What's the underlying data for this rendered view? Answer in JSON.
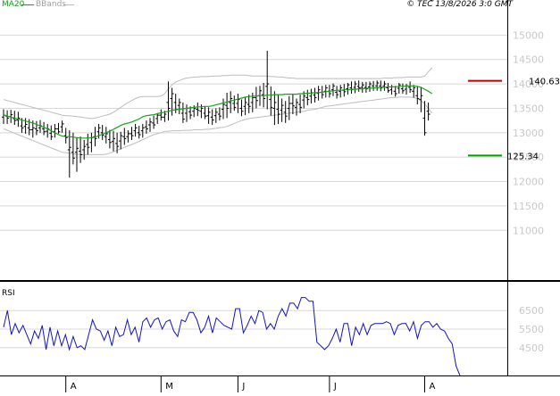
{
  "header": {
    "ma_label": "MA20",
    "bb_label": "BBands",
    "copyright": "© TEC 13/8/2026 3:0 GMT"
  },
  "colors": {
    "price_bars": "#000000",
    "ma": "#18a21b",
    "bbands": "#bdbdbd",
    "rsi": "#1515b8",
    "resistance": "#c00000",
    "support": "#00a000",
    "grid": "#d8d8d8",
    "frame": "#000000",
    "tick_text": "#c8c8c8"
  },
  "chart_data": [
    {
      "type": "bar",
      "subtype": "ohlc",
      "x_labels": [
        "A",
        "M",
        "J",
        "J",
        "A"
      ],
      "x_label_bar_index": [
        17,
        43,
        64,
        89,
        115
      ],
      "ylim": [
        1000,
        1550
      ],
      "y_ticks": [
        "11000",
        "11500",
        "12000",
        "12500",
        "13000",
        "13500",
        "14000",
        "14500",
        "15000"
      ],
      "y_tick_values": [
        1100,
        1150,
        1200,
        1250,
        1300,
        1350,
        1400,
        1450,
        1500
      ],
      "grid": true,
      "levels": [
        {
          "label": "140.63",
          "value": 1406.3,
          "kind": "resistance"
        },
        {
          "label": "125.34",
          "value": 1253.4,
          "kind": "support"
        }
      ],
      "series": [
        {
          "name": "MA20",
          "kind": "moving-average",
          "values": [
            1337,
            1334,
            1332,
            1330,
            1328,
            1326,
            1324,
            1322,
            1320,
            1317,
            1314,
            1311,
            1308,
            1304,
            1300,
            1296,
            1293,
            1292,
            1292,
            1291,
            1290,
            1289,
            1289,
            1289,
            1290,
            1291,
            1294,
            1297,
            1300,
            1303,
            1307,
            1311,
            1315,
            1318,
            1320,
            1322,
            1325,
            1328,
            1333,
            1335,
            1336,
            1337,
            1339,
            1341,
            1342,
            1344,
            1346,
            1347,
            1348,
            1349,
            1350,
            1351,
            1352,
            1353,
            1353,
            1354,
            1354,
            1355,
            1357,
            1359,
            1361,
            1363,
            1365,
            1367,
            1369,
            1371,
            1373,
            1374,
            1375,
            1375,
            1376,
            1376,
            1377,
            1377,
            1378,
            1378,
            1378,
            1379,
            1379,
            1379,
            1379,
            1380,
            1380,
            1381,
            1381,
            1382,
            1382,
            1383,
            1384,
            1385,
            1386,
            1387,
            1387,
            1388,
            1388,
            1389,
            1389,
            1390,
            1390,
            1391,
            1391,
            1392,
            1392,
            1393,
            1393,
            1394,
            1394,
            1394,
            1395,
            1395,
            1396,
            1396,
            1396,
            1395,
            1393,
            1389,
            1385,
            1380
          ]
        },
        {
          "name": "BBands",
          "kind": "band-upper",
          "values": [
            1368,
            1366,
            1364,
            1362,
            1360,
            1358,
            1356,
            1354,
            1352,
            1350,
            1348,
            1346,
            1344,
            1342,
            1340,
            1338,
            1336,
            1335,
            1335,
            1334,
            1333,
            1332,
            1331,
            1330,
            1329,
            1330,
            1332,
            1334,
            1336,
            1338,
            1342,
            1347,
            1352,
            1357,
            1362,
            1366,
            1370,
            1373,
            1374,
            1374,
            1374,
            1374,
            1374,
            1375,
            1380,
            1390,
            1398,
            1404,
            1407,
            1410,
            1412,
            1413,
            1414,
            1414,
            1415,
            1415,
            1415,
            1416,
            1416,
            1416,
            1417,
            1417,
            1418,
            1418,
            1418,
            1418,
            1418,
            1417,
            1416,
            1416,
            1416,
            1416,
            1416,
            1415,
            1415,
            1414,
            1414,
            1413,
            1412,
            1412,
            1411,
            1411,
            1411,
            1411,
            1411,
            1411,
            1411,
            1411,
            1411,
            1411,
            1411,
            1411,
            1411,
            1411,
            1411,
            1411,
            1411,
            1411,
            1411,
            1411,
            1411,
            1411,
            1411,
            1411,
            1412,
            1412,
            1412,
            1413,
            1413,
            1413,
            1414,
            1414,
            1414,
            1414,
            1414,
            1416,
            1425,
            1433
          ]
        },
        {
          "name": "BBands",
          "kind": "band-lower",
          "values": [
            1308,
            1305,
            1302,
            1299,
            1296,
            1293,
            1290,
            1287,
            1284,
            1281,
            1278,
            1275,
            1272,
            1269,
            1266,
            1263,
            1260,
            1259,
            1258,
            1257,
            1256,
            1255,
            1255,
            1255,
            1255,
            1255,
            1255,
            1255,
            1256,
            1258,
            1261,
            1264,
            1267,
            1270,
            1273,
            1276,
            1279,
            1282,
            1286,
            1289,
            1293,
            1296,
            1298,
            1300,
            1303,
            1303,
            1304,
            1304,
            1304,
            1305,
            1305,
            1305,
            1306,
            1306,
            1306,
            1307,
            1307,
            1308,
            1309,
            1310,
            1311,
            1313,
            1316,
            1319,
            1322,
            1325,
            1327,
            1329,
            1330,
            1331,
            1332,
            1333,
            1334,
            1335,
            1336,
            1337,
            1338,
            1339,
            1340,
            1341,
            1342,
            1343,
            1344,
            1346,
            1347,
            1348,
            1350,
            1352,
            1354,
            1355,
            1356,
            1357,
            1358,
            1359,
            1360,
            1361,
            1362,
            1363,
            1364,
            1365,
            1366,
            1367,
            1368,
            1369,
            1370,
            1371,
            1372,
            1372,
            1373,
            1373,
            1373,
            1373,
            1372,
            1370,
            1366,
            1359,
            1350,
            1340
          ]
        },
        {
          "name": "price",
          "kind": "ohlc-bars",
          "high": [
            1348,
            1346,
            1347,
            1345,
            1343,
            1330,
            1330,
            1328,
            1325,
            1324,
            1326,
            1322,
            1318,
            1315,
            1318,
            1320,
            1325,
            1310,
            1305,
            1300,
            1290,
            1292,
            1285,
            1298,
            1300,
            1312,
            1318,
            1316,
            1312,
            1306,
            1304,
            1300,
            1302,
            1310,
            1305,
            1312,
            1318,
            1314,
            1318,
            1325,
            1330,
            1335,
            1340,
            1348,
            1345,
            1405,
            1392,
            1380,
            1370,
            1362,
            1358,
            1354,
            1356,
            1362,
            1358,
            1354,
            1352,
            1348,
            1350,
            1352,
            1370,
            1382,
            1385,
            1376,
            1380,
            1368,
            1372,
            1378,
            1382,
            1394,
            1396,
            1402,
            1468,
            1395,
            1385,
            1378,
            1370,
            1365,
            1375,
            1380,
            1370,
            1378,
            1385,
            1388,
            1390,
            1392,
            1396,
            1396,
            1398,
            1398,
            1401,
            1396,
            1398,
            1400,
            1402,
            1405,
            1406,
            1407,
            1404,
            1404,
            1405,
            1406,
            1407,
            1407,
            1406,
            1402,
            1398,
            1396,
            1402,
            1401,
            1400,
            1405,
            1398,
            1395,
            1394,
            1365,
            1362
          ],
          "low": [
            1318,
            1318,
            1320,
            1316,
            1312,
            1300,
            1298,
            1295,
            1290,
            1295,
            1300,
            1295,
            1290,
            1285,
            1290,
            1298,
            1300,
            1278,
            1208,
            1235,
            1220,
            1238,
            1245,
            1255,
            1260,
            1272,
            1288,
            1285,
            1278,
            1268,
            1262,
            1258,
            1266,
            1275,
            1280,
            1285,
            1292,
            1288,
            1290,
            1298,
            1302,
            1308,
            1318,
            1325,
            1322,
            1325,
            1335,
            1340,
            1338,
            1320,
            1322,
            1328,
            1332,
            1334,
            1330,
            1328,
            1318,
            1316,
            1320,
            1325,
            1328,
            1330,
            1340,
            1345,
            1340,
            1334,
            1336,
            1340,
            1342,
            1350,
            1355,
            1352,
            1348,
            1335,
            1316,
            1318,
            1322,
            1320,
            1326,
            1338,
            1335,
            1340,
            1350,
            1356,
            1360,
            1362,
            1366,
            1370,
            1372,
            1372,
            1375,
            1370,
            1372,
            1374,
            1378,
            1380,
            1381,
            1384,
            1382,
            1382,
            1384,
            1386,
            1386,
            1385,
            1386,
            1382,
            1378,
            1374,
            1380,
            1380,
            1378,
            1382,
            1372,
            1358,
            1342,
            1294,
            1325
          ],
          "open": [
            1332,
            1334,
            1333,
            1329,
            1326,
            1314,
            1313,
            1310,
            1306,
            1308,
            1310,
            1308,
            1303,
            1299,
            1302,
            1308,
            1312,
            1294,
            1265,
            1260,
            1260,
            1262,
            1265,
            1276,
            1280,
            1292,
            1302,
            1300,
            1292,
            1286,
            1282,
            1278,
            1283,
            1292,
            1292,
            1298,
            1304,
            1300,
            1304,
            1312,
            1316,
            1320,
            1329,
            1336,
            1332,
            1362,
            1370,
            1362,
            1356,
            1340,
            1340,
            1343,
            1344,
            1348,
            1344,
            1340,
            1335,
            1332,
            1335,
            1338,
            1348,
            1356,
            1362,
            1360,
            1360,
            1350,
            1354,
            1358,
            1362,
            1372,
            1376,
            1378,
            1395,
            1368,
            1350,
            1348,
            1346,
            1342,
            1350,
            1360,
            1352,
            1358,
            1367,
            1372,
            1375,
            1377,
            1381,
            1383,
            1385,
            1385,
            1388,
            1383,
            1385,
            1387,
            1390,
            1392,
            1393,
            1395,
            1393,
            1393,
            1394,
            1396,
            1396,
            1396,
            1396,
            1392,
            1388,
            1385,
            1391,
            1390,
            1389,
            1393,
            1385,
            1376,
            1368,
            1330,
            1344
          ],
          "close": [
            1336,
            1330,
            1337,
            1325,
            1330,
            1310,
            1317,
            1306,
            1310,
            1304,
            1314,
            1302,
            1308,
            1292,
            1308,
            1302,
            1318,
            1290,
            1270,
            1248,
            1268,
            1255,
            1272,
            1270,
            1290,
            1288,
            1310,
            1295,
            1298,
            1280,
            1288,
            1272,
            1294,
            1288,
            1298,
            1294,
            1310,
            1296,
            1310,
            1308,
            1322,
            1316,
            1336,
            1332,
            1338,
            1350,
            1380,
            1348,
            1362,
            1328,
            1350,
            1336,
            1350,
            1346,
            1350,
            1334,
            1342,
            1326,
            1342,
            1334,
            1358,
            1350,
            1370,
            1352,
            1368,
            1344,
            1362,
            1354,
            1372,
            1366,
            1386,
            1370,
            1400,
            1352,
            1362,
            1338,
            1356,
            1334,
            1360,
            1355,
            1362,
            1352,
            1375,
            1368,
            1382,
            1372,
            1388,
            1378,
            1392,
            1380,
            1396,
            1378,
            1392,
            1384,
            1398,
            1388,
            1400,
            1392,
            1398,
            1390,
            1400,
            1392,
            1402,
            1392,
            1400,
            1386,
            1394,
            1380,
            1398,
            1386,
            1396,
            1388,
            1392,
            1370,
            1376,
            1300,
            1338
          ]
        }
      ]
    },
    {
      "type": "line",
      "title": "RSI",
      "x_labels": [
        "A",
        "M",
        "J",
        "J",
        "A"
      ],
      "ylim": [
        30,
        80
      ],
      "y_ticks": [
        "4500",
        "5500",
        "6500"
      ],
      "y_tick_values": [
        45,
        55,
        65
      ],
      "grid": true,
      "series": [
        {
          "name": "RSI",
          "values": [
            56,
            65,
            52,
            58,
            53,
            57,
            52,
            47,
            54,
            50,
            57,
            44,
            56,
            46,
            54,
            46,
            52,
            44,
            51,
            45,
            46,
            44,
            52,
            60,
            55,
            54,
            49,
            54,
            46,
            56,
            51,
            52,
            60,
            52,
            56,
            48,
            59,
            61,
            56,
            60,
            61,
            55,
            59,
            60,
            54,
            51,
            60,
            59,
            64,
            64,
            60,
            53,
            56,
            62,
            53,
            61,
            59,
            57,
            56,
            55,
            66,
            66,
            53,
            57,
            62,
            58,
            65,
            64,
            55,
            58,
            55,
            62,
            66,
            62,
            69,
            69,
            66,
            72,
            72,
            70,
            70,
            48,
            46,
            44,
            46,
            50,
            55,
            48,
            58,
            58,
            46,
            56,
            52,
            58,
            52,
            57,
            58,
            58,
            58,
            59,
            58,
            52,
            57,
            58,
            58,
            54,
            59,
            50,
            57,
            59,
            59,
            56,
            58,
            55,
            54,
            50,
            47,
            35,
            30
          ]
        }
      ]
    }
  ]
}
